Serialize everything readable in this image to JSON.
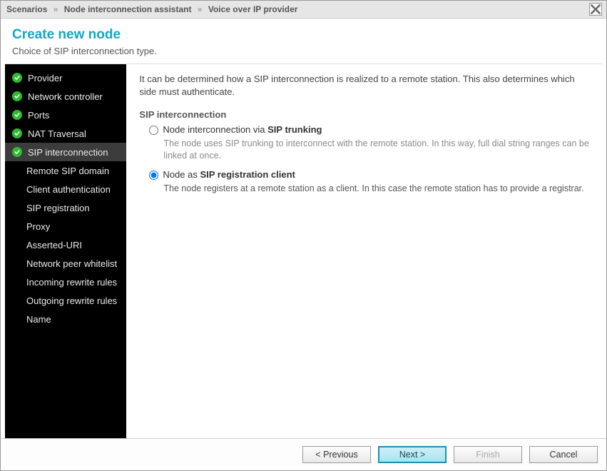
{
  "breadcrumb": {
    "part1": "Scenarios",
    "part2": "Node interconnection assistant",
    "part3": "Voice over IP provider",
    "sep": "»"
  },
  "header": {
    "title": "Create new node",
    "subtitle": "Choice of SIP interconnection type."
  },
  "sidebar": {
    "items": [
      {
        "label": "Provider",
        "done": true,
        "selected": false,
        "sub": false
      },
      {
        "label": "Network controller",
        "done": true,
        "selected": false,
        "sub": false
      },
      {
        "label": "Ports",
        "done": true,
        "selected": false,
        "sub": false
      },
      {
        "label": "NAT Traversal",
        "done": true,
        "selected": false,
        "sub": false
      },
      {
        "label": "SIP interconnection",
        "done": true,
        "selected": true,
        "sub": false
      },
      {
        "label": "Remote SIP domain",
        "done": false,
        "selected": false,
        "sub": true
      },
      {
        "label": "Client authentication",
        "done": false,
        "selected": false,
        "sub": true
      },
      {
        "label": "SIP registration",
        "done": false,
        "selected": false,
        "sub": true
      },
      {
        "label": "Proxy",
        "done": false,
        "selected": false,
        "sub": true
      },
      {
        "label": "Asserted-URI",
        "done": false,
        "selected": false,
        "sub": true
      },
      {
        "label": "Network peer whitelist",
        "done": false,
        "selected": false,
        "sub": true
      },
      {
        "label": "Incoming rewrite rules",
        "done": false,
        "selected": false,
        "sub": true
      },
      {
        "label": "Outgoing rewrite rules",
        "done": false,
        "selected": false,
        "sub": true
      },
      {
        "label": "Name",
        "done": false,
        "selected": false,
        "sub": true
      }
    ]
  },
  "content": {
    "intro": "It can be determined how a SIP interconnection is realized to a remote station. This also determines which side must authenticate.",
    "section_title": "SIP interconnection",
    "options": [
      {
        "label_pre": "Node interconnection via ",
        "label_bold": "SIP trunking",
        "label_post": "",
        "desc": "The node uses SIP trunking to interconnect with the remote station. In this way, full dial string ranges can be linked at once.",
        "checked": false
      },
      {
        "label_pre": "Node as ",
        "label_bold": "SIP registration client",
        "label_post": "",
        "desc": "The node registers at a remote station as a client. In this case the remote station has to provide a registrar.",
        "checked": true
      }
    ]
  },
  "footer": {
    "previous": "< Previous",
    "next": "Next >",
    "finish": "Finish",
    "cancel": "Cancel"
  }
}
